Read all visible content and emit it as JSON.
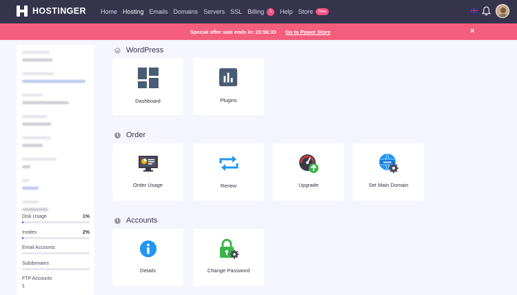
{
  "brand": {
    "name": "HOSTINGER"
  },
  "nav": {
    "links": [
      {
        "label": "Home"
      },
      {
        "label": "Hosting"
      },
      {
        "label": "Emails"
      },
      {
        "label": "Domains"
      },
      {
        "label": "Servers"
      },
      {
        "label": "SSL"
      },
      {
        "label": "Billing",
        "badge": "1"
      },
      {
        "label": "Help"
      },
      {
        "label": "Store",
        "badge": "New"
      }
    ],
    "active": "Hosting"
  },
  "promo": {
    "text": "Special offer sale ends in: 23:56:33",
    "link": "Go to Power Store",
    "close": "×"
  },
  "sidebar": {
    "usage": [
      {
        "label": "Disk Usage",
        "percent": "1%",
        "fill": 0.01
      },
      {
        "label": "Inodes",
        "percent": "2%",
        "fill": 0.02
      },
      {
        "label": "Email Accounts",
        "percent": "",
        "fill": 0
      },
      {
        "label": "Subdomains",
        "percent": "",
        "fill": 0
      }
    ],
    "ftp": {
      "label": "FTP Accounts",
      "value": "1"
    }
  },
  "sections": {
    "wordpress": {
      "title": "WordPress",
      "cards": [
        "Dashboard",
        "Plugins"
      ]
    },
    "order": {
      "title": "Order",
      "cards": [
        "Order Usage",
        "Renew",
        "Upgrade",
        "Set Main Domain"
      ]
    },
    "accounts": {
      "title": "Accounts",
      "cards": [
        "Details",
        "Change Password"
      ]
    }
  },
  "colors": {
    "nav_bg": "#36344d",
    "promo_bg": "#f55d7c",
    "accent_blue": "#2196f3",
    "slate": "#4a5c72",
    "green": "#3bb54a",
    "usage_fill": "#673de6"
  }
}
